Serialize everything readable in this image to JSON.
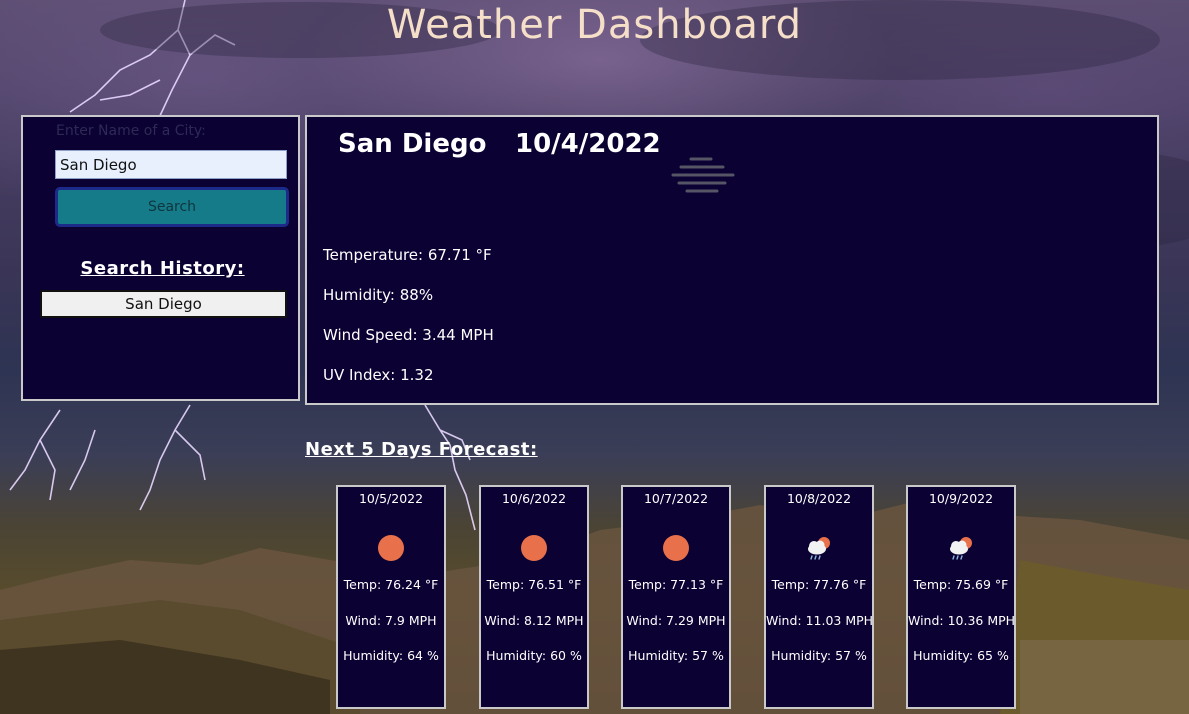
{
  "page": {
    "title": "Weather Dashboard"
  },
  "search": {
    "label": "Enter Name of a City:",
    "value": "San Diego",
    "button_label": "Search",
    "history_heading": "Search History:",
    "history": [
      "San Diego"
    ]
  },
  "current": {
    "city": "San Diego",
    "date": "10/4/2022",
    "icon": "mist-icon",
    "temperature": "Temperature: 67.71 °F",
    "humidity": "Humidity: 88%",
    "wind": "Wind Speed: 3.44 MPH",
    "uv": "UV Index:  1.32"
  },
  "forecast": {
    "heading": "Next 5 Days Forecast:",
    "days": [
      {
        "date": "10/5/2022",
        "icon": "sun-icon",
        "temp": "Temp: 76.24 °F",
        "wind": "Wind: 7.9 MPH",
        "humidity": "Humidity: 64 %"
      },
      {
        "date": "10/6/2022",
        "icon": "sun-icon",
        "temp": "Temp: 76.51 °F",
        "wind": "Wind: 8.12 MPH",
        "humidity": "Humidity: 60 %"
      },
      {
        "date": "10/7/2022",
        "icon": "sun-icon",
        "temp": "Temp: 77.13 °F",
        "wind": "Wind: 7.29 MPH",
        "humidity": "Humidity: 57 %"
      },
      {
        "date": "10/8/2022",
        "icon": "rain-cloud-sun-icon",
        "temp": "Temp: 77.76 °F",
        "wind": "Wind: 11.03 MPH",
        "humidity": "Humidity: 57 %"
      },
      {
        "date": "10/9/2022",
        "icon": "rain-cloud-sun-icon",
        "temp": "Temp: 75.69 °F",
        "wind": "Wind: 10.36 MPH",
        "humidity": "Humidity: 65 %"
      }
    ]
  },
  "colors": {
    "panel": "#0b0133",
    "title": "#f5dfc8",
    "button": "#167b88",
    "sun": "#e8704a"
  }
}
